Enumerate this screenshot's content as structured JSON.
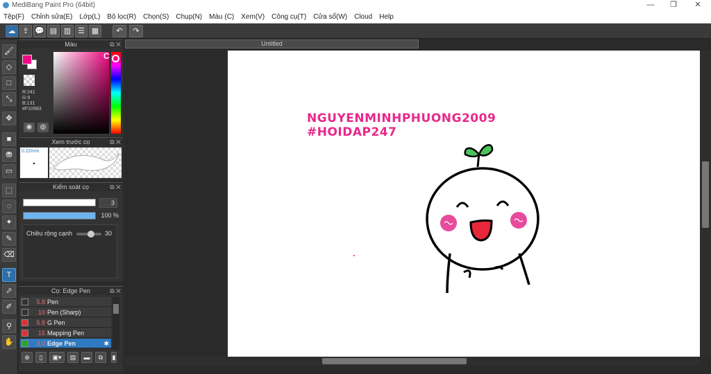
{
  "window": {
    "title": "MediBang Paint Pro (64bit)",
    "minimize": "—",
    "restore": "❐",
    "close": "✕"
  },
  "menu": [
    "Tệp(F)",
    "Chỉnh sửa(E)",
    "Lớp(L)",
    "Bộ lọc(R)",
    "Chọn(S)",
    "Chụp(N)",
    "Màu (C)",
    "Xem(V)",
    "Công cụ(T)",
    "Cửa sổ(W)",
    "Cloud",
    "Help"
  ],
  "toolbar_icons": [
    "cloud-icon",
    "share-icon",
    "comment-icon",
    "chat-icon",
    "document-icon",
    "list-icon",
    "grid-icon"
  ],
  "toolbar_glyphs": [
    "☁",
    "⇪",
    "💬",
    "▤",
    "▥",
    "☰",
    "▦"
  ],
  "undo": "↶",
  "redo": "↷",
  "tools": [
    {
      "name": "brush-tool-icon",
      "glyph": "🖌",
      "active": false
    },
    {
      "name": "eraser-tool-icon",
      "glyph": "◇",
      "active": false
    },
    {
      "name": "rect-tool-icon",
      "glyph": "□",
      "active": false
    },
    {
      "name": "dot-tool-icon",
      "glyph": "⤡",
      "active": false
    },
    {
      "name": "move-tool-icon",
      "glyph": "✥",
      "active": false
    },
    {
      "name": "fill-rect-tool-icon",
      "glyph": "■",
      "active": false
    },
    {
      "name": "bucket-tool-icon",
      "glyph": "⛃",
      "active": false
    },
    {
      "name": "gradient-tool-icon",
      "glyph": "▭",
      "active": false
    },
    {
      "name": "select-tool-icon",
      "glyph": "⬚",
      "active": false
    },
    {
      "name": "lasso-tool-icon",
      "glyph": "◌",
      "active": false
    },
    {
      "name": "magic-wand-tool-icon",
      "glyph": "✦",
      "active": false
    },
    {
      "name": "select-pen-tool-icon",
      "glyph": "✎",
      "active": false
    },
    {
      "name": "select-eraser-tool-icon",
      "glyph": "⌫",
      "active": false
    },
    {
      "name": "text-tool-icon",
      "glyph": "T",
      "active": true
    },
    {
      "name": "operation-tool-icon",
      "glyph": "⬀",
      "active": false
    },
    {
      "name": "divide-tool-icon",
      "glyph": "✐",
      "active": false
    },
    {
      "name": "eyedropper-tool-icon",
      "glyph": "⚲",
      "active": false
    },
    {
      "name": "hand-tool-icon",
      "glyph": "✋",
      "active": false
    }
  ],
  "color_panel": {
    "title": "Màu",
    "r": "R:241",
    "g": "G:9",
    "b": "B:131",
    "hex": "#F10983",
    "c_label": "C",
    "fg": "#F10983"
  },
  "preview_panel": {
    "title": "Xem trước cọ",
    "size": "0.22mm"
  },
  "control_panel": {
    "title": "Kiểm soát cọ",
    "size_value": "3",
    "opacity": "100 %",
    "edge_label": "Chiều rộng cạnh",
    "edge_value": "30",
    "size_fill": 1.0,
    "opacity_fill": 1.0,
    "edge_fill": 0.6
  },
  "brush_panel": {
    "title": "Cọ: Edge Pen",
    "items": [
      {
        "size": "5.8",
        "name": "Pen",
        "color": "#333333"
      },
      {
        "size": "10",
        "name": "Pen (Sharp)",
        "color": "#333333"
      },
      {
        "size": "5.8",
        "name": "G Pen",
        "color": "#e03030"
      },
      {
        "size": "15",
        "name": "Mapping Pen",
        "color": "#e03030"
      },
      {
        "size": "3.0",
        "name": "Edge Pen",
        "color": "#22aa22",
        "selected": true
      }
    ]
  },
  "doc_tab": "Untitled",
  "canvas_text": {
    "line1": "NGUYENMINHPHUONG2009",
    "line2": "#HOIDAP247",
    "color": "#e8288c"
  }
}
